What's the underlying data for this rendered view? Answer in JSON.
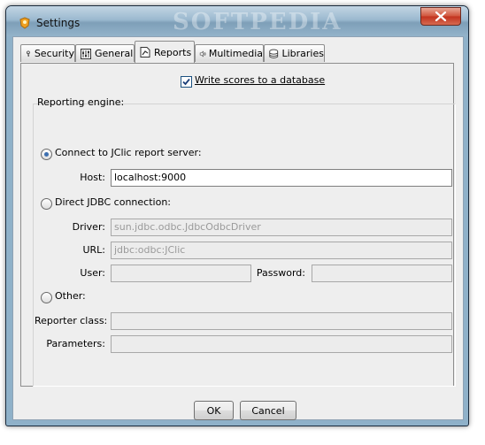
{
  "window": {
    "title": "Settings",
    "watermark": "SOFTPEDIA"
  },
  "tabs": [
    {
      "label": "Security",
      "icon": "lock-icon"
    },
    {
      "label": "General",
      "icon": "sliders-icon"
    },
    {
      "label": "Reports",
      "icon": "report-icon",
      "active": true
    },
    {
      "label": "Multimedia",
      "icon": "speaker-icon"
    },
    {
      "label": "Libraries",
      "icon": "database-icon"
    }
  ],
  "reports": {
    "write_scores_label": "Write scores to a database",
    "write_scores_checked": true,
    "engine_label": "Reporting engine:",
    "report_server": {
      "label": "Connect to JClic report server:",
      "selected": true,
      "host_label": "Host:",
      "host_value": "localhost:9000"
    },
    "jdbc": {
      "label": "Direct JDBC connection:",
      "driver_label": "Driver:",
      "driver_value": "sun.jdbc.odbc.JdbcOdbcDriver",
      "url_label": "URL:",
      "url_value": "jdbc:odbc:JClic",
      "user_label": "User:",
      "user_value": "",
      "password_label": "Password:",
      "password_value": ""
    },
    "other": {
      "label": "Other:",
      "reporter_class_label": "Reporter class:",
      "reporter_class_value": "",
      "parameters_label": "Parameters:",
      "parameters_value": ""
    }
  },
  "buttons": {
    "ok": "OK",
    "cancel": "Cancel"
  },
  "colors": {
    "accent": "#3d6fb0",
    "close": "#c2321e"
  }
}
